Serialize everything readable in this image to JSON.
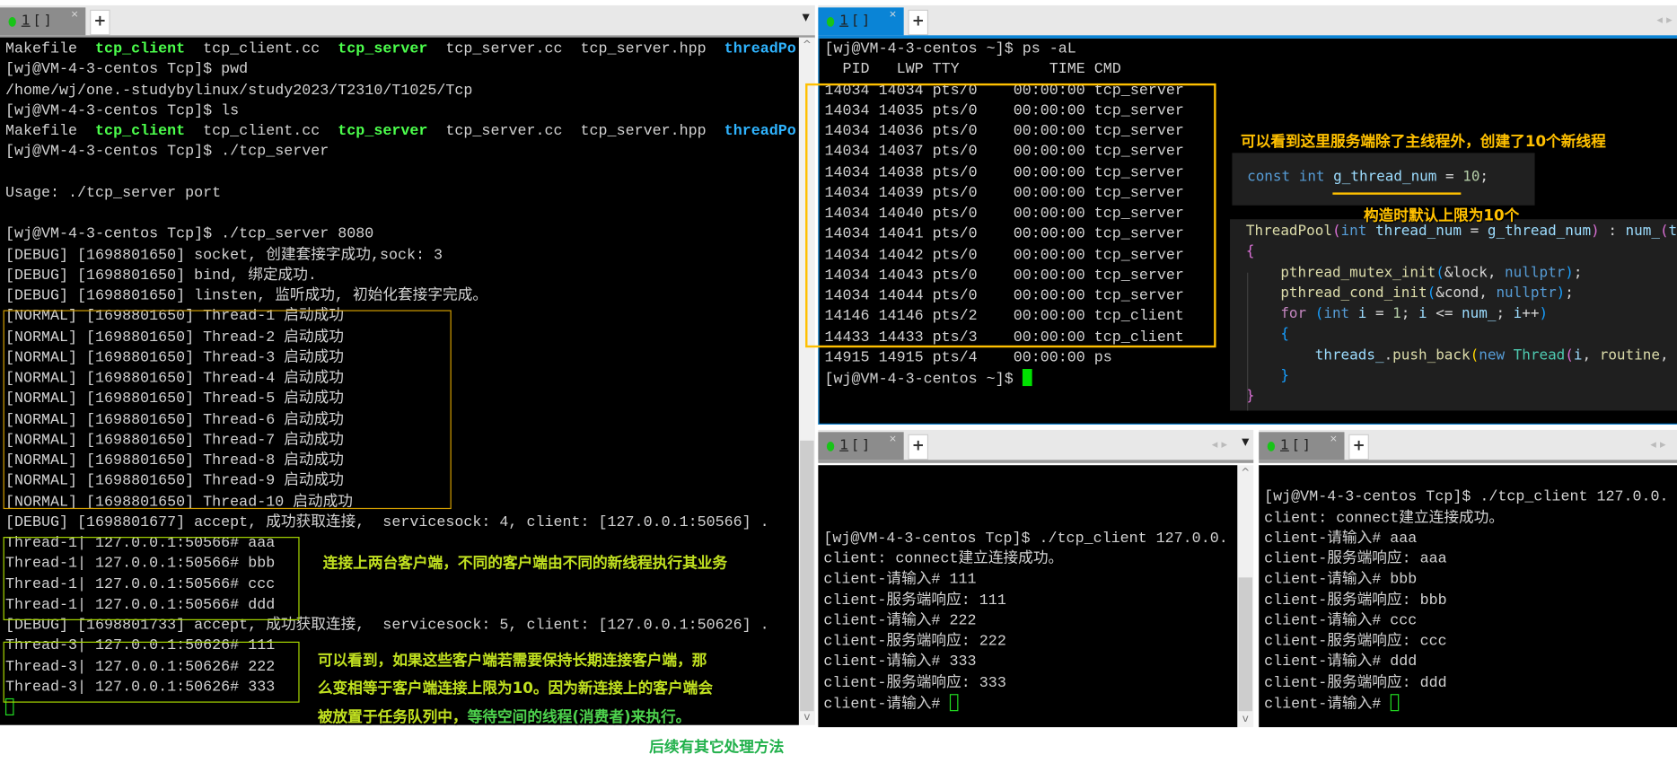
{
  "tabs": {
    "label_num": "1",
    "label_rest": " [ ]",
    "close": "×",
    "add": "+"
  },
  "colors": {
    "accent": "#0a84d6",
    "exe_green": "#4cff4c",
    "dir_blue": "#2fb4ff",
    "note_yellow": "#ffc000",
    "note_green": "#c0e020"
  },
  "left_terminal": {
    "lines": [
      [
        {
          "t": "Makefile  "
        },
        {
          "t": "tcp_client",
          "c": "g"
        },
        {
          "t": "  tcp_client.cc  "
        },
        {
          "t": "tcp_server",
          "c": "g"
        },
        {
          "t": "  tcp_server.cc  tcp_server.hpp  "
        },
        {
          "t": "threadPo",
          "c": "b"
        }
      ],
      "[wj@VM-4-3-centos Tcp]$ pwd",
      "/home/wj/one.-studybylinux/study2023/T2310/T1025/Tcp",
      "[wj@VM-4-3-centos Tcp]$ ls",
      [
        {
          "t": "Makefile  "
        },
        {
          "t": "tcp_client",
          "c": "g"
        },
        {
          "t": "  tcp_client.cc  "
        },
        {
          "t": "tcp_server",
          "c": "g"
        },
        {
          "t": "  tcp_server.cc  tcp_server.hpp  "
        },
        {
          "t": "threadPo",
          "c": "b"
        }
      ],
      "[wj@VM-4-3-centos Tcp]$ ./tcp_server",
      "",
      "Usage: ./tcp_server port",
      "",
      "[wj@VM-4-3-centos Tcp]$ ./tcp_server 8080",
      "[DEBUG] [1698801650] socket, 创建套接字成功,sock: 3",
      "[DEBUG] [1698801650] bind, 绑定成功.",
      "[DEBUG] [1698801650] linsten, 监听成功, 初始化套接字完成。",
      "[NORMAL] [1698801650] Thread-1 启动成功",
      "[NORMAL] [1698801650] Thread-2 启动成功",
      "[NORMAL] [1698801650] Thread-3 启动成功",
      "[NORMAL] [1698801650] Thread-4 启动成功",
      "[NORMAL] [1698801650] Thread-5 启动成功",
      "[NORMAL] [1698801650] Thread-6 启动成功",
      "[NORMAL] [1698801650] Thread-7 启动成功",
      "[NORMAL] [1698801650] Thread-8 启动成功",
      "[NORMAL] [1698801650] Thread-9 启动成功",
      "[NORMAL] [1698801650] Thread-10 启动成功",
      "[DEBUG] [1698801677] accept, 成功获取连接,  servicesock: 4, client: [127.0.0.1:50566] .",
      "Thread-1| 127.0.0.1:50566# aaa",
      "Thread-1| 127.0.0.1:50566# bbb",
      "Thread-1| 127.0.0.1:50566# ccc",
      "Thread-1| 127.0.0.1:50566# ddd",
      "[DEBUG] [1698801733] accept, 成功获取连接,  servicesock: 5, client: [127.0.0.1:50626] .",
      "Thread-3| 127.0.0.1:50626# 111",
      "Thread-3| 127.0.0.1:50626# 222",
      "Thread-3| 127.0.0.1:50626# 333",
      [
        {
          "t": "",
          "c": "cursor-o"
        }
      ]
    ]
  },
  "ps_terminal": {
    "lines": [
      "[wj@VM-4-3-centos ~]$ ps -aL",
      "  PID   LWP TTY          TIME CMD",
      "14034 14034 pts/0    00:00:00 tcp_server",
      "14034 14035 pts/0    00:00:00 tcp_server",
      "14034 14036 pts/0    00:00:00 tcp_server",
      "14034 14037 pts/0    00:00:00 tcp_server",
      "14034 14038 pts/0    00:00:00 tcp_server",
      "14034 14039 pts/0    00:00:00 tcp_server",
      "14034 14040 pts/0    00:00:00 tcp_server",
      "14034 14041 pts/0    00:00:00 tcp_server",
      "14034 14042 pts/0    00:00:00 tcp_server",
      "14034 14043 pts/0    00:00:00 tcp_server",
      "14034 14044 pts/0    00:00:00 tcp_server",
      "14146 14146 pts/2    00:00:00 tcp_client",
      "14433 14433 pts/3    00:00:00 tcp_client",
      "14915 14915 pts/4    00:00:00 ps",
      [
        {
          "t": "[wj@VM-4-3-centos ~]$ "
        },
        {
          "t": "",
          "c": "cursor-f"
        }
      ]
    ]
  },
  "client1_terminal": {
    "lines": [
      "",
      "",
      "",
      "[wj@VM-4-3-centos Tcp]$ ./tcp_client 127.0.0.",
      "client: connect建立连接成功。",
      "client-请输入# 111",
      "client-服务端响应: 111",
      "client-请输入# 222",
      "client-服务端响应: 222",
      "client-请输入# 333",
      "client-服务端响应: 333",
      [
        {
          "t": "client-请输入# "
        },
        {
          "t": "",
          "c": "cursor-o"
        }
      ]
    ]
  },
  "client2_terminal": {
    "lines": [
      "",
      "[wj@VM-4-3-centos Tcp]$ ./tcp_client 127.0.0.",
      "client: connect建立连接成功。",
      "client-请输入# aaa",
      "client-服务端响应: aaa",
      "client-请输入# bbb",
      "client-服务端响应: bbb",
      "client-请输入# ccc",
      "client-服务端响应: ccc",
      "client-请输入# ddd",
      "client-服务端响应: ddd",
      [
        {
          "t": "client-请输入# "
        },
        {
          "t": "",
          "c": "cursor-o"
        }
      ]
    ]
  },
  "code_const": {
    "lines": [
      [
        {
          "t": "const int ",
          "c": "#569cd6"
        },
        {
          "t": "g_thread_num",
          "c": "#9cdcfe"
        },
        {
          "t": " = ",
          "c": "#d4d4d4"
        },
        {
          "t": "10",
          "c": "#b5cea8"
        },
        {
          "t": ";",
          "c": "#d4d4d4"
        }
      ]
    ]
  },
  "code_ctor": {
    "lines": [
      [
        {
          "t": "ThreadPool",
          "c": "#dcdcaa"
        },
        {
          "t": "(",
          "c": "#da70d6"
        },
        {
          "t": "int ",
          "c": "#569cd6"
        },
        {
          "t": "thread_num",
          "c": "#9cdcfe"
        },
        {
          "t": " = ",
          "c": "#d4d4d4"
        },
        {
          "t": "g_thread_num",
          "c": "#9cdcfe"
        },
        {
          "t": ")",
          "c": "#da70d6"
        },
        {
          "t": " : ",
          "c": "#d4d4d4"
        },
        {
          "t": "num_",
          "c": "#9cdcfe"
        },
        {
          "t": "(",
          "c": "#da70d6"
        },
        {
          "t": "t",
          "c": "#9cdcfe"
        }
      ],
      [
        {
          "t": "{",
          "c": "#da70d6"
        }
      ],
      [
        {
          "t": "    pthread_mutex_init",
          "c": "#dcdcaa"
        },
        {
          "t": "(",
          "c": "#179fff"
        },
        {
          "t": "&lock, ",
          "c": "#d4d4d4"
        },
        {
          "t": "nullptr",
          "c": "#569cd6"
        },
        {
          "t": ")",
          "c": "#179fff"
        },
        {
          "t": ";",
          "c": "#d4d4d4"
        }
      ],
      [
        {
          "t": "    pthread_cond_init",
          "c": "#dcdcaa"
        },
        {
          "t": "(",
          "c": "#179fff"
        },
        {
          "t": "&cond, ",
          "c": "#d4d4d4"
        },
        {
          "t": "nullptr",
          "c": "#569cd6"
        },
        {
          "t": ")",
          "c": "#179fff"
        },
        {
          "t": ";",
          "c": "#d4d4d4"
        }
      ],
      [
        {
          "t": "    for ",
          "c": "#c586c0"
        },
        {
          "t": "(",
          "c": "#179fff"
        },
        {
          "t": "int ",
          "c": "#569cd6"
        },
        {
          "t": "i",
          "c": "#9cdcfe"
        },
        {
          "t": " = ",
          "c": "#d4d4d4"
        },
        {
          "t": "1",
          "c": "#b5cea8"
        },
        {
          "t": "; ",
          "c": "#d4d4d4"
        },
        {
          "t": "i",
          "c": "#9cdcfe"
        },
        {
          "t": " <= ",
          "c": "#d4d4d4"
        },
        {
          "t": "num_",
          "c": "#9cdcfe"
        },
        {
          "t": "; ",
          "c": "#d4d4d4"
        },
        {
          "t": "i",
          "c": "#9cdcfe"
        },
        {
          "t": "++",
          "c": "#d4d4d4"
        },
        {
          "t": ")",
          "c": "#179fff"
        }
      ],
      [
        {
          "t": "    {",
          "c": "#179fff"
        }
      ],
      [
        {
          "t": "        threads_",
          "c": "#9cdcfe"
        },
        {
          "t": ".",
          "c": "#d4d4d4"
        },
        {
          "t": "push_back",
          "c": "#dcdcaa"
        },
        {
          "t": "(",
          "c": "#ffd700"
        },
        {
          "t": "new ",
          "c": "#569cd6"
        },
        {
          "t": "Thread",
          "c": "#4ec9b0"
        },
        {
          "t": "(",
          "c": "#da70d6"
        },
        {
          "t": "i",
          "c": "#9cdcfe"
        },
        {
          "t": ", ",
          "c": "#d4d4d4"
        },
        {
          "t": "routine",
          "c": "#dcdcaa"
        },
        {
          "t": ",",
          "c": "#d4d4d4"
        }
      ],
      [
        {
          "t": "    }",
          "c": "#179fff"
        }
      ],
      [
        {
          "t": "}",
          "c": "#da70d6"
        }
      ]
    ]
  },
  "annotations": {
    "threads_created": "可以看到这里服务端除了主线程外，创建了10个新线程",
    "default_limit": "构造时默认上限为10个",
    "two_clients": "连接上两台客户端，不同的客户端由不同的新线程执行其业务",
    "limit_line1": "可以看到，如果这些客户端若需要保持长期连接客户端，那",
    "limit_line2": "么变相等于客户端连接上限为10。因为新连接上的客户端会",
    "limit_line3a": "被放置于任务队列中，",
    "limit_line3b": "等待空间的线程(消费者)来执行。",
    "followup": "后续有其它处理方法"
  }
}
